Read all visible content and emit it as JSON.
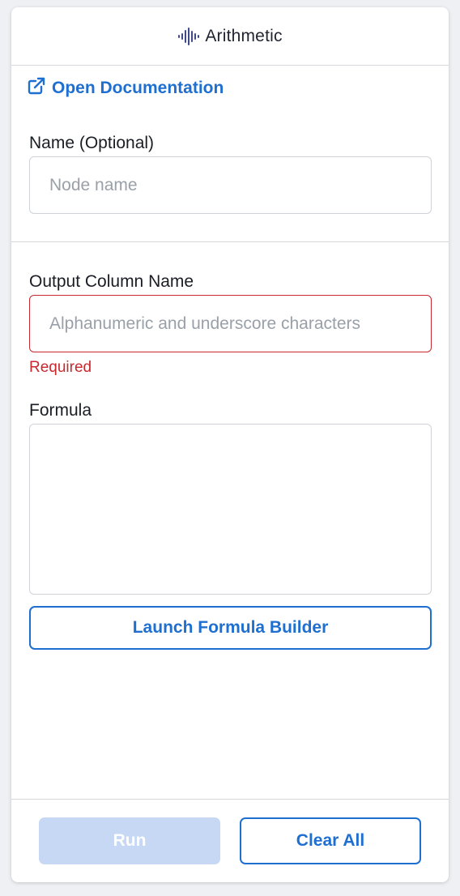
{
  "header": {
    "title": "Arithmetic",
    "icon": "waveform-icon"
  },
  "documentation": {
    "label": "Open Documentation",
    "icon": "external-link-icon"
  },
  "name_field": {
    "label": "Name (Optional)",
    "placeholder": "Node name",
    "value": ""
  },
  "output_field": {
    "label": "Output Column Name",
    "placeholder": "Alphanumeric and underscore characters",
    "value": "",
    "error": "Required"
  },
  "formula": {
    "label": "Formula",
    "value": "",
    "builder_label": "Launch Formula Builder"
  },
  "footer": {
    "run_label": "Run",
    "clear_label": "Clear All"
  },
  "colors": {
    "accent": "#1f6fd1",
    "error": "#c8282e",
    "disabled": "#c6d8f4",
    "icon": "#3f4a8a"
  }
}
